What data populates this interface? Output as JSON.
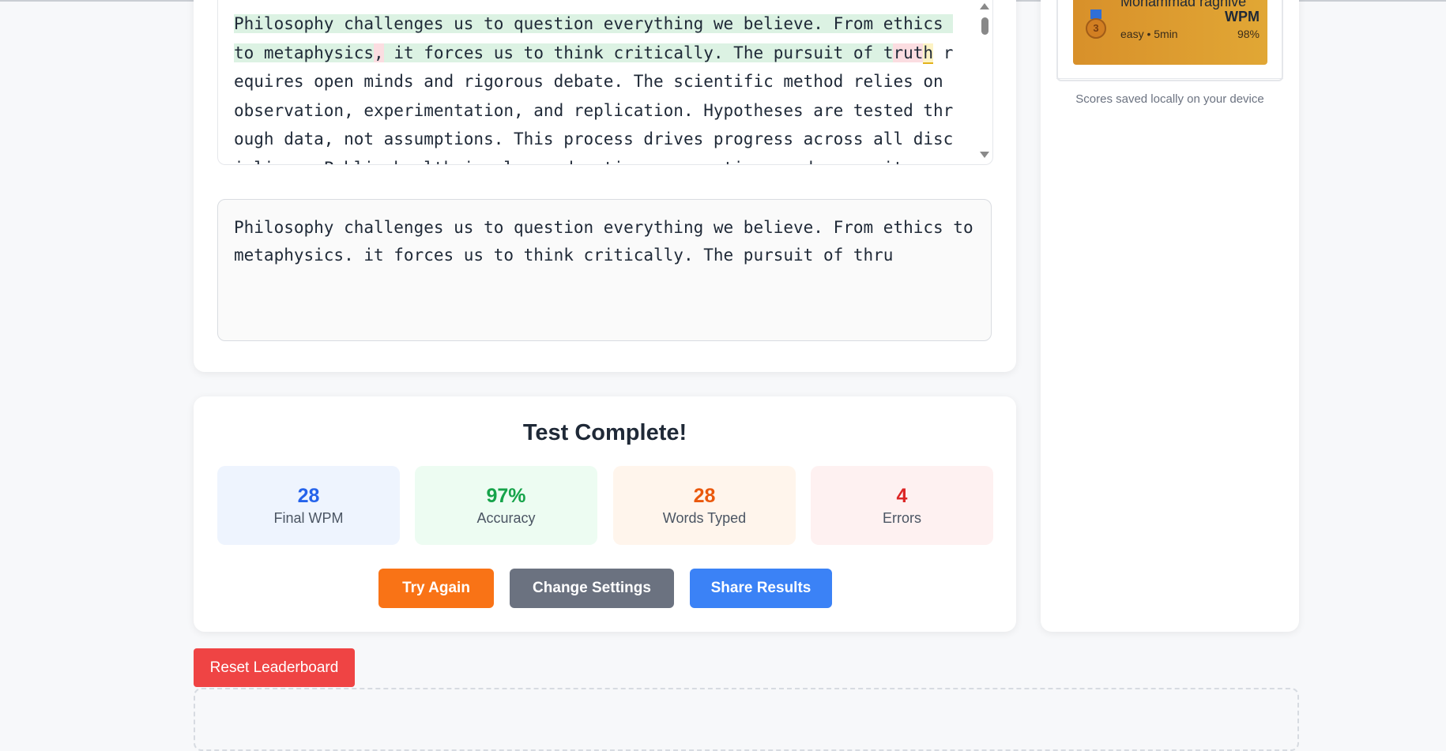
{
  "passage": {
    "correct_1": "Philosophy challenges us to question everything we believe. From ethics to metaphysics",
    "error_1": ",",
    "correct_2": " it forces us to think critically. The pursuit of t",
    "error_2": "rut",
    "current": "h",
    "remaining": " requires open minds and rigorous debate. The scientific method relies on observation, experimentation, and replication. Hypotheses are tested through data, not assumptions. This process drives progress across all disciplines. Public health involves education, prevention, and community support. Vaccin"
  },
  "input": {
    "value": "Philosophy challenges us to question everything we believe. From ethics to metaphysics. it forces us to think critically. The pursuit of thru"
  },
  "results": {
    "title": "Test Complete!",
    "stats": [
      {
        "value": "28",
        "label": "Final WPM"
      },
      {
        "value": "97%",
        "label": "Accuracy"
      },
      {
        "value": "28",
        "label": "Words Typed"
      },
      {
        "value": "4",
        "label": "Errors"
      }
    ],
    "buttons": {
      "try_again": "Try Again",
      "change_settings": "Change Settings",
      "share_results": "Share Results"
    }
  },
  "leaderboard": {
    "entry": {
      "rank": "3",
      "name": "Mohammad raghive",
      "score": "WPM",
      "meta": "easy • 5min",
      "accuracy": "98%",
      "medal_color": "#d27f22"
    },
    "saved_note": "Scores saved locally on your device",
    "reset_label": "Reset Leaderboard"
  }
}
